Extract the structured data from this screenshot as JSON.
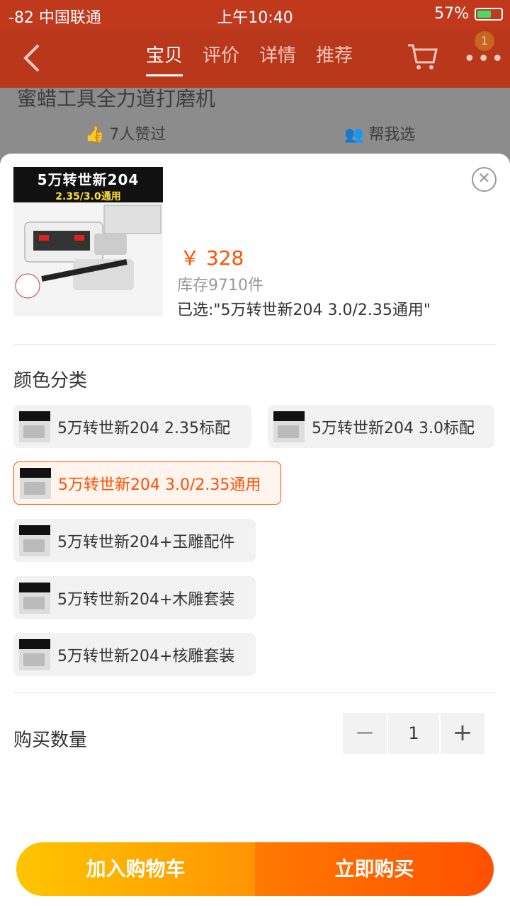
{
  "status_bar": {
    "carrier": "-82 中国联通",
    "time": "上午10:40",
    "battery": "57%",
    "battery_level": 0.57
  },
  "nav": {
    "tabs": [
      {
        "label": "宝贝",
        "active": true
      },
      {
        "label": "评价"
      },
      {
        "label": "详情"
      },
      {
        "label": "推荐"
      }
    ],
    "badge": "1",
    "back_icon": "chevron-left-icon",
    "cart_icon": "cart-icon",
    "more_icon": "more-icon"
  },
  "underlying": {
    "title": "蜜蜡工具全力道打磨机",
    "likes": "7人赞过",
    "help_choose": "帮我选"
  },
  "product": {
    "thumb_line1": "5万转世新204",
    "thumb_line2": "2.35/3.0通用",
    "price": "￥ 328",
    "stock": "库存9710件",
    "selected": "已选:\"5万转世新204 3.0/2.35通用\""
  },
  "color_section": {
    "title": "颜色分类",
    "options": [
      {
        "label": "5万转世新204 2.35标配",
        "selected": false
      },
      {
        "label": "5万转世新204 3.0标配",
        "selected": false
      },
      {
        "label": "5万转世新204 3.0/2.35通用",
        "selected": true
      },
      {
        "label": "5万转世新204+玉雕配件",
        "selected": false
      },
      {
        "label": "5万转世新204+木雕套装",
        "selected": false
      },
      {
        "label": "5万转世新204+核雕套装",
        "selected": false
      }
    ]
  },
  "quantity": {
    "label": "购买数量",
    "minus": "−",
    "value": "1",
    "plus": "+"
  },
  "actions": {
    "add_to_cart": "加入购物车",
    "buy_now": "立即购买"
  },
  "colors": {
    "accent": "#ff5000",
    "cart_start": "#ffc500",
    "buy_end": "#ff5000"
  }
}
